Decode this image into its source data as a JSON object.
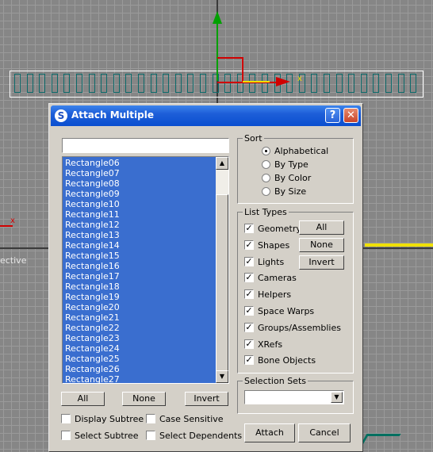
{
  "viewport": {
    "view_label": "ective",
    "gizmo_label": "x"
  },
  "dialog": {
    "title": "Attach Multiple",
    "help_label": "?",
    "close_label": "✕",
    "filter_value": "",
    "list_items": [
      "Rectangle06",
      "Rectangle07",
      "Rectangle08",
      "Rectangle09",
      "Rectangle10",
      "Rectangle11",
      "Rectangle12",
      "Rectangle13",
      "Rectangle14",
      "Rectangle15",
      "Rectangle16",
      "Rectangle17",
      "Rectangle18",
      "Rectangle19",
      "Rectangle20",
      "Rectangle21",
      "Rectangle22",
      "Rectangle23",
      "Rectangle24",
      "Rectangle25",
      "Rectangle26",
      "Rectangle27"
    ],
    "list_buttons": {
      "all": "All",
      "none": "None",
      "invert": "Invert"
    },
    "options": {
      "display_subtree": "Display Subtree",
      "case_sensitive": "Case Sensitive",
      "select_subtree": "Select Subtree",
      "select_dependents": "Select Dependents"
    },
    "sort": {
      "label": "Sort",
      "options": [
        "Alphabetical",
        "By Type",
        "By Color",
        "By Size"
      ],
      "selected": "Alphabetical"
    },
    "list_types": {
      "label": "List Types",
      "items": [
        "Geometry",
        "Shapes",
        "Lights",
        "Cameras",
        "Helpers",
        "Space Warps",
        "Groups/Assemblies",
        "XRefs",
        "Bone Objects"
      ],
      "all_label": "All",
      "none_label": "None",
      "invert_label": "Invert"
    },
    "selection_sets": {
      "label": "Selection Sets",
      "value": ""
    },
    "attach_label": "Attach",
    "cancel_label": "Cancel"
  },
  "colors": {
    "title_bar": "#0a4fd0",
    "list_bg": "#3a6ecf",
    "dialog_bg": "#d4d0c8",
    "viewport_bg": "#868686"
  }
}
